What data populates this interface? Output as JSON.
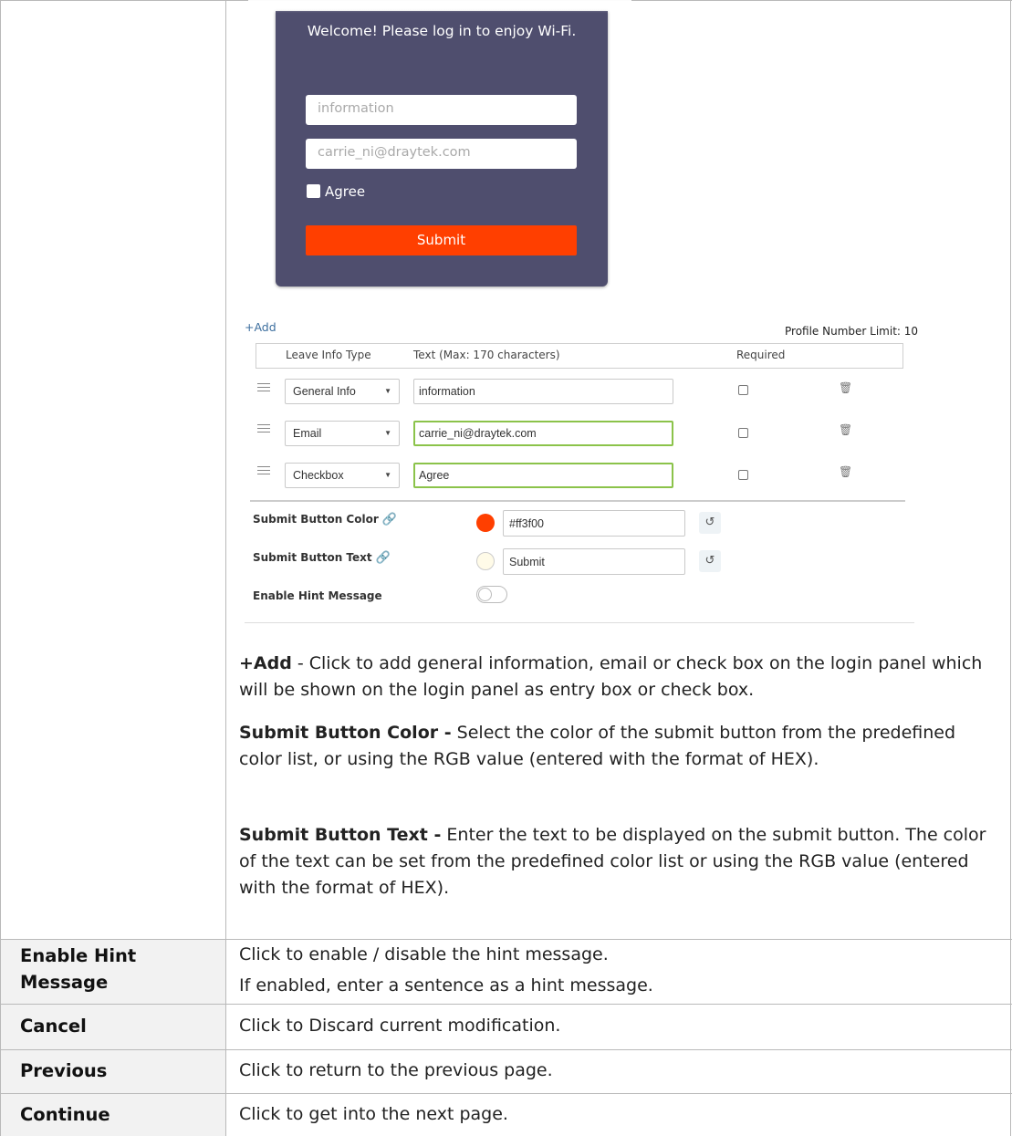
{
  "login_preview": {
    "welcome": "Welcome! Please log in to enjoy Wi-Fi.",
    "field1_placeholder": "information",
    "field2_placeholder": "carrie_ni@draytek.com",
    "agree_label": "Agree",
    "submit_label": "Submit",
    "panel_color": "#4f4e6e",
    "submit_color": "#ff3f00"
  },
  "settings": {
    "add_label": "+Add",
    "profile_limit": "Profile Number Limit: 10",
    "columns": [
      "Leave Info Type",
      "Text (Max: 170 characters)",
      "Required"
    ],
    "rows": [
      {
        "type": "General Info",
        "text": "information"
      },
      {
        "type": "Email",
        "text": "carrie_ni@draytek.com"
      },
      {
        "type": "Checkbox",
        "text": "Agree"
      }
    ],
    "submit_color_label": "Submit Button Color",
    "submit_color_value": "#ff3f00",
    "submit_color_swatch": "#ff3f00",
    "submit_text_label": "Submit Button Text",
    "submit_text_value": "Submit",
    "submit_text_swatch": "#fffbe8",
    "hint_label": "Enable Hint Message",
    "hint_enabled": false
  },
  "descriptions": {
    "add_term": "+Add",
    "add_text": " - Click to add general information, email or check box on the login panel which will be shown on the login panel as entry box or check box.",
    "color_term": "Submit Button Color -",
    "color_text": " Select the color of the submit button from the predefined color list, or using the RGB value (entered with the format of HEX).",
    "text_term": "Submit Button Text -",
    "text_text": " Enter the text to be displayed on the submit button. The color of the text can be set from the predefined color list or using the RGB value (entered with the format of HEX)."
  },
  "table_rows": [
    {
      "term": "Enable Hint Message",
      "text1": "Click to enable / disable the hint message.",
      "text2": "If enabled, enter a sentence as a hint message."
    },
    {
      "term": "Cancel",
      "text1": "Click to Discard current modification."
    },
    {
      "term": "Previous",
      "text1": "Click to return to the previous page."
    },
    {
      "term": "Continue",
      "text1": "Click to get into the next page."
    }
  ]
}
